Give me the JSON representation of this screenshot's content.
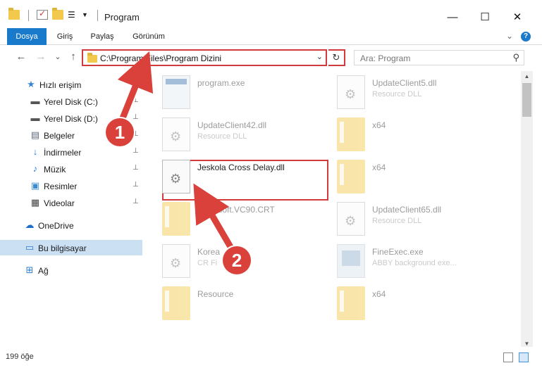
{
  "window": {
    "title": "Program",
    "minimize_glyph": "—",
    "maximize_glyph": "☐",
    "close_glyph": "✕"
  },
  "ribbon": {
    "tabs": [
      "Dosya",
      "Giriş",
      "Paylaş",
      "Görünüm"
    ],
    "active_tab": "Dosya",
    "expand_glyph": "⌄",
    "help_glyph": "?"
  },
  "address_bar": {
    "path": "C:\\Program Files\\Program Dizini",
    "dropdown_glyph": "⌄",
    "refresh_glyph": "↻"
  },
  "search": {
    "placeholder": "Ara: Program",
    "icon_glyph": "⚲"
  },
  "nav_buttons": {
    "back": "←",
    "forward": "→",
    "recent": "⌄",
    "up": "↑"
  },
  "sidebar": {
    "items": [
      {
        "label": "Hızlı erişim",
        "icon": "star-icon",
        "glyph": "★",
        "color": "#3a86d4",
        "pinned": false
      },
      {
        "label": "Yerel Disk (C:)",
        "icon": "drive-icon",
        "glyph": "▬",
        "color": "#555555",
        "pinned": true
      },
      {
        "label": "Yerel Disk (D:)",
        "icon": "drive-icon",
        "glyph": "▬",
        "color": "#555555",
        "pinned": true
      },
      {
        "label": "Belgeler",
        "icon": "documents-icon",
        "glyph": "▤",
        "color": "#5a6b7d",
        "pinned": true
      },
      {
        "label": "İndirmeler",
        "icon": "download-icon",
        "glyph": "↓",
        "color": "#2d7fd1",
        "pinned": true
      },
      {
        "label": "Müzik",
        "icon": "music-icon",
        "glyph": "♪",
        "color": "#2d7fd1",
        "pinned": true
      },
      {
        "label": "Resimler",
        "icon": "pictures-icon",
        "glyph": "▣",
        "color": "#3b8bd1",
        "pinned": true
      },
      {
        "label": "Videolar",
        "icon": "video-icon",
        "glyph": "▦",
        "color": "#444444",
        "pinned": true
      },
      {
        "label": "OneDrive",
        "icon": "cloud-icon",
        "glyph": "☁",
        "color": "#1e6fc9",
        "pinned": false
      },
      {
        "label": "Bu bilgisayar",
        "icon": "computer-icon",
        "glyph": "▭",
        "color": "#2b7ccc",
        "pinned": false,
        "selected": true
      },
      {
        "label": "Ağ",
        "icon": "network-icon",
        "glyph": "⊞",
        "color": "#2b7ccc",
        "pinned": false
      }
    ],
    "pin_glyph": "📌"
  },
  "files": [
    {
      "name": "program.exe",
      "type": "",
      "icon": "exe-icon"
    },
    {
      "name": "UpdateClient5.dll",
      "type": "Resource DLL",
      "icon": "dll-icon"
    },
    {
      "name": "UpdateClient42.dll",
      "type": "Resource DLL",
      "icon": "dll-icon"
    },
    {
      "name": "x64",
      "type": "",
      "icon": "folder-icon"
    },
    {
      "name": "Jeskola Cross Delay.dll",
      "type": "",
      "icon": "dll-icon"
    },
    {
      "name": "x64",
      "type": "",
      "icon": "folder-icon"
    },
    {
      "name": "Microsoft.VC90.CRT",
      "type": "",
      "icon": "folder-icon"
    },
    {
      "name": "UpdateClient65.dll",
      "type": "Resource DLL",
      "icon": "dll-icon"
    },
    {
      "name": "Korea",
      "type": "CR Fi",
      "icon": "doc-icon"
    },
    {
      "name": "FineExec.exe",
      "type": "ABBY background exe...",
      "icon": "app-icon"
    },
    {
      "name": "Resource",
      "type": "",
      "icon": "folder-icon"
    },
    {
      "name": "x64",
      "type": "",
      "icon": "folder-icon"
    }
  ],
  "annotations": {
    "step1": "1",
    "step2": "2",
    "color": "#d9413a"
  },
  "status": {
    "count": "199 öğe"
  },
  "scroll": {
    "up": "▲",
    "down": "▼"
  }
}
